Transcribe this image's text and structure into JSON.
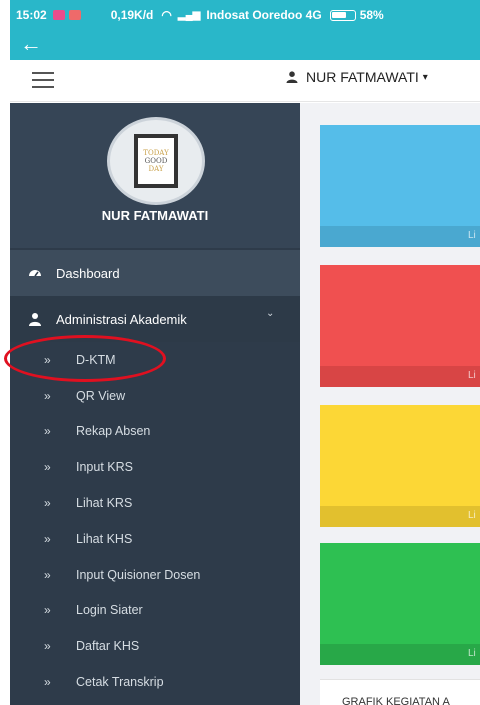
{
  "status_bar": {
    "time": "15:02",
    "speed": "0,19K/d",
    "carrier": "Indosat Ooredoo 4G",
    "battery": "58%"
  },
  "app_bar": {
    "back_icon": "arrow-left-icon"
  },
  "top_nav": {
    "menu_icon": "hamburger-icon",
    "user_name": "NUR FATMAWATI",
    "user_icon": "user-icon",
    "caret": "▾"
  },
  "sidebar": {
    "profile": {
      "name": "NUR FATMAWATI",
      "avatar_text": [
        "TODAY",
        "GOOD",
        "DAY"
      ]
    },
    "menu": [
      {
        "label": "Dashboard",
        "icon": "dashboard-icon"
      },
      {
        "label": "Administrasi Akademik",
        "icon": "user-icon",
        "expanded": true
      }
    ],
    "submenu": [
      {
        "label": "D-KTM",
        "highlighted": true
      },
      {
        "label": "QR View"
      },
      {
        "label": "Rekap Absen"
      },
      {
        "label": "Input KRS"
      },
      {
        "label": "Lihat KRS"
      },
      {
        "label": "Lihat KHS"
      },
      {
        "label": "Input Quisioner Dosen"
      },
      {
        "label": "Login Siater"
      },
      {
        "label": "Daftar KHS"
      },
      {
        "label": "Cetak Transkrip"
      }
    ]
  },
  "content": {
    "cards": [
      {
        "color": "#55bde9",
        "footer": "Li"
      },
      {
        "color": "#f05050",
        "footer": "Li"
      },
      {
        "color": "#fcd736",
        "footer": "Li"
      },
      {
        "color": "#2ec052",
        "footer": "Li"
      }
    ],
    "section_title": "GRAFIK KEGIATAN A"
  },
  "colors": {
    "teal": "#29b7c9",
    "sidebar": "#2e3b4a",
    "highlight": "#e01020"
  }
}
